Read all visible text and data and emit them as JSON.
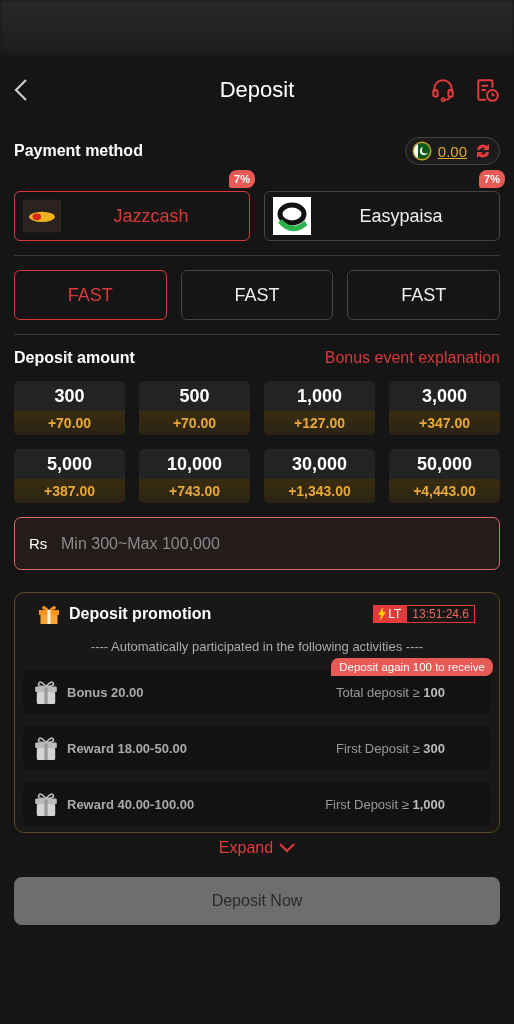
{
  "header": {
    "title": "Deposit"
  },
  "payment": {
    "label": "Payment method",
    "balance": "0.00"
  },
  "methods": [
    {
      "name": "Jazzcash",
      "badge": "7%",
      "selected": true
    },
    {
      "name": "Easypaisa",
      "badge": "7%",
      "selected": false
    }
  ],
  "channels": [
    {
      "label": "FAST",
      "selected": true
    },
    {
      "label": "FAST",
      "selected": false
    },
    {
      "label": "FAST",
      "selected": false
    }
  ],
  "amount": {
    "label": "Deposit amount",
    "link": "Bonus event explanation"
  },
  "amounts": [
    {
      "value": "300",
      "bonus": "+70.00"
    },
    {
      "value": "500",
      "bonus": "+70.00"
    },
    {
      "value": "1,000",
      "bonus": "+127.00"
    },
    {
      "value": "3,000",
      "bonus": "+347.00"
    },
    {
      "value": "5,000",
      "bonus": "+387.00"
    },
    {
      "value": "10,000",
      "bonus": "+743.00"
    },
    {
      "value": "30,000",
      "bonus": "+1,343.00"
    },
    {
      "value": "50,000",
      "bonus": "+4,443.00"
    }
  ],
  "input": {
    "prefix": "Rs",
    "placeholder": "Min 300~Max 100,000"
  },
  "promotion": {
    "title": "Deposit promotion",
    "tag": "LT",
    "timer": "13:51:24.6",
    "subtitle": "---- Automatically participated in the following activities ----",
    "activities": [
      {
        "name": "Bonus 20.00",
        "condition": "Total deposit ≥ **100**",
        "tooltip": "Deposit again 100 to receive"
      },
      {
        "name": "Reward 18.00-50.00",
        "condition": "First Deposit ≥ **300**"
      },
      {
        "name": "Reward 40.00-100.00",
        "condition": "First Deposit ≥ **1,000**"
      }
    ]
  },
  "expand": "Expand",
  "submit": {
    "label": "Deposit Now",
    "disabled": true
  }
}
